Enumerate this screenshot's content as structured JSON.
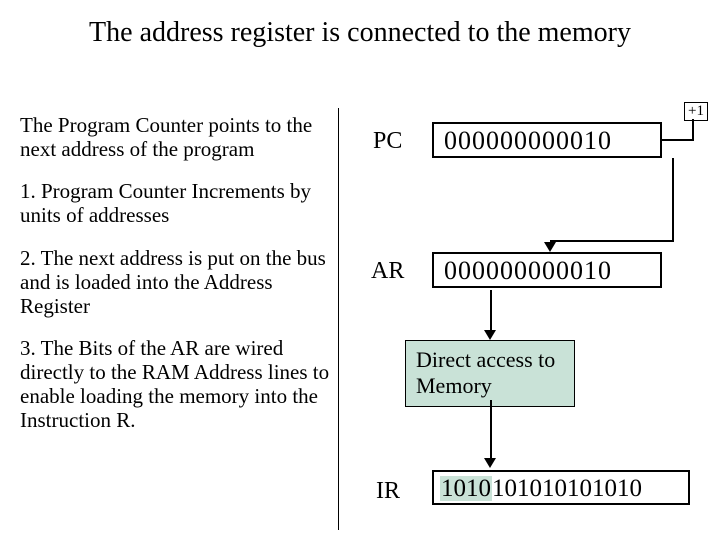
{
  "title": "The address register is connected to the memory",
  "left": {
    "intro": "The Program Counter points to the next address of the program",
    "step1": "1.  Program Counter Increments by units of addresses",
    "step2": "2. The next address is put on the bus and is loaded into the Address Register",
    "step3": "3. The Bits of the AR are wired directly to the RAM Address lines to enable loading the memory into the Instruction R."
  },
  "registers": {
    "pc_label": "PC",
    "pc_value": "000000000010",
    "ar_label": "AR",
    "ar_value": "000000000010",
    "ir_label": "IR",
    "ir_value_hl": "1010",
    "ir_value_rest": "101010101010"
  },
  "increment_label": "+1",
  "memory_box": "Direct access to Memory"
}
